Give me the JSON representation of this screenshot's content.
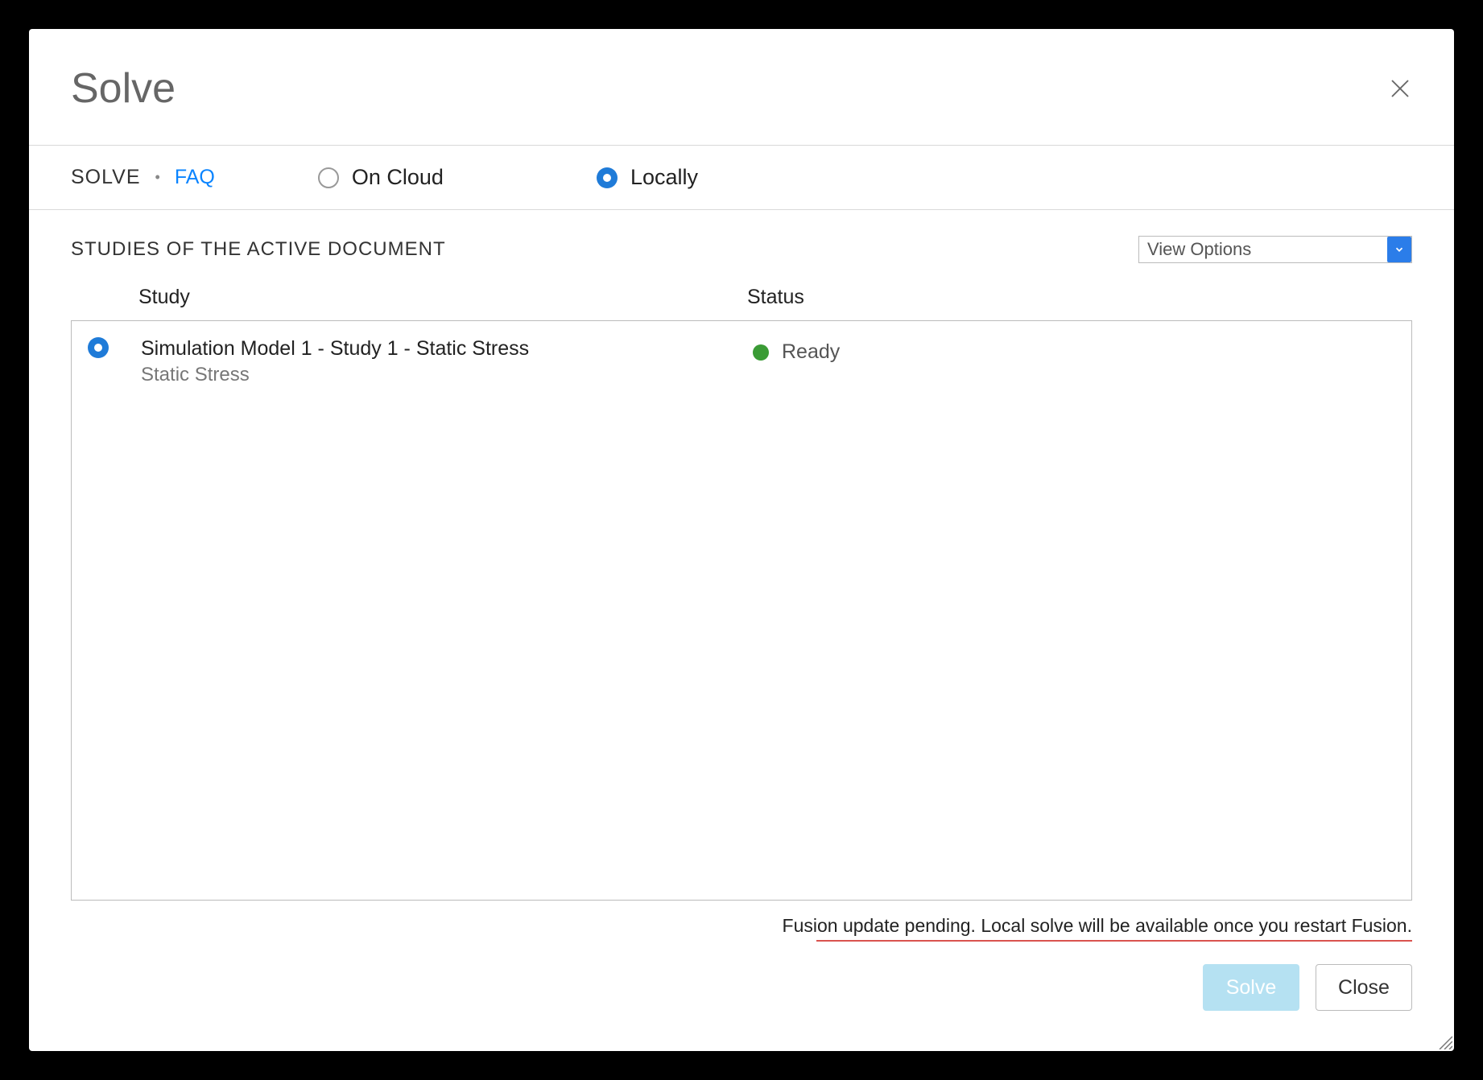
{
  "dialog": {
    "title": "Solve"
  },
  "tabs": {
    "solve": "SOLVE",
    "faq": "FAQ"
  },
  "location": {
    "cloud": "On Cloud",
    "local": "Locally",
    "selected": "local"
  },
  "section": {
    "title": "STUDIES OF THE ACTIVE DOCUMENT",
    "view_options": "View Options"
  },
  "columns": {
    "study": "Study",
    "status": "Status"
  },
  "studies": [
    {
      "name": "Simulation Model 1 - Study 1 - Static Stress",
      "type": "Static Stress",
      "status": "Ready",
      "status_color": "#3a9b35",
      "selected": true
    }
  ],
  "footer": {
    "message": "Fusion update pending. Local solve will be available once you restart Fusion."
  },
  "buttons": {
    "solve": "Solve",
    "close": "Close"
  }
}
